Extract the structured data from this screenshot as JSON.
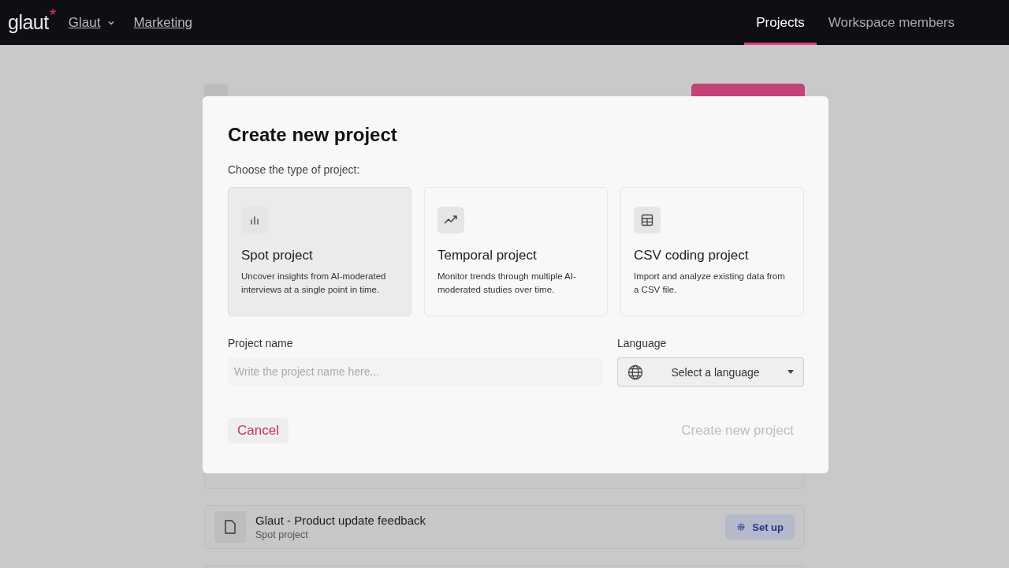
{
  "topbar": {
    "logo": "glaut",
    "logo_mark": "*",
    "breadcrumbs": [
      {
        "label": "Glaut",
        "has_menu": true
      },
      {
        "label": "Marketing",
        "has_menu": false
      }
    ],
    "tabs": [
      {
        "label": "Projects",
        "selected": true
      },
      {
        "label": "Workspace members",
        "selected": false
      }
    ]
  },
  "projects": [
    {
      "kind": "covered"
    },
    {
      "kind": "project",
      "name": "Glaut - Product update feedback",
      "type": "Spot project",
      "action": "Set up"
    },
    {
      "kind": "covered"
    }
  ],
  "modal": {
    "title": "Create new project",
    "prompt": "Choose the type of project:",
    "types": [
      {
        "title": "Spot project",
        "description": "Uncover insights from AI-moderated interviews at a single point in time.",
        "selected": true
      },
      {
        "title": "Temporal project",
        "description": "Monitor trends through multiple AI-moderated studies over time.",
        "selected": false
      },
      {
        "title": "CSV coding project",
        "description": "Import and analyze existing data from a CSV file.",
        "selected": false
      }
    ],
    "project_name": {
      "label": "Project name",
      "placeholder": "Write the project name here..."
    },
    "language": {
      "label": "Language",
      "value": "Select a language"
    },
    "cancel": {
      "label": "Cancel"
    },
    "create": {
      "label": "Create new project",
      "disabled": true
    }
  }
}
